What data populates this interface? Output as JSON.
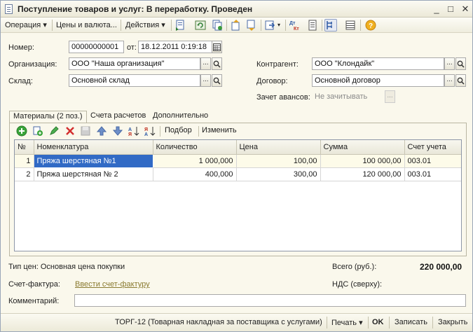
{
  "window": {
    "title": "Поступление товаров и услуг: В переработку. Проведен",
    "controls": [
      "_",
      "□",
      "✕"
    ]
  },
  "toolbar": {
    "operation": "Операция",
    "prices": "Цены и валюта...",
    "actions": "Действия",
    "icons": [
      "post-document-icon",
      "refresh-icon",
      "copy-icon",
      "move-up-icon",
      "move-down-icon",
      "go-to-icon",
      "dt-kt-icon",
      "register-icon",
      "structure-icon",
      "list-icon",
      "help-icon"
    ]
  },
  "form": {
    "number_label": "Номер:",
    "number_value": "00000000001",
    "date_label": "от:",
    "date_value": "18.12.2011  0:19:18",
    "org_label": "Организация:",
    "org_value": "ООО \"Наша организация\"",
    "warehouse_label": "Склад:",
    "warehouse_value": "Основной склад",
    "contractor_label": "Контрагент:",
    "contractor_value": "ООО \"Клондайк\"",
    "contract_label": "Договор:",
    "contract_value": "Основной договор",
    "advance_label": "Зачет авансов:",
    "advance_value": "Не зачитывать"
  },
  "tabs": [
    {
      "label": "Материалы (2 поз.)",
      "active": true
    },
    {
      "label": "Счета расчетов",
      "active": false
    },
    {
      "label": "Дополнительно",
      "active": false
    }
  ],
  "grid_toolbar": {
    "selection": "Подбор",
    "change": "Изменить"
  },
  "table": {
    "columns": [
      "№",
      "Номенклатура",
      "Количество",
      "Цена",
      "Сумма",
      "Счет учета"
    ],
    "rows": [
      [
        "1",
        "Пряжа шерстяная №1",
        "1 000,000",
        "100,00",
        "100 000,00",
        "003.01"
      ],
      [
        "2",
        "Пряжа шерстяная № 2",
        "400,000",
        "300,00",
        "120 000,00",
        "003.01"
      ]
    ]
  },
  "footer": {
    "price_type": "Тип цен: Основная цена покупки",
    "total_label": "Всего (руб.):",
    "total_value": "220 000,00",
    "invoice_label": "Счет-фактура:",
    "invoice_link": "Ввести счет-фактуру",
    "vat_label": "НДС (сверху):",
    "comment_label": "Комментарий:",
    "comment_value": ""
  },
  "bottom_bar": {
    "torg": "ТОРГ-12 (Товарная накладная за поставщика с услугами)",
    "print": "Печать",
    "ok": "OK",
    "save": "Записать",
    "close": "Закрыть"
  },
  "colors": {
    "window_bg": "#faf8ec",
    "selection": "#316ac5",
    "link": "#8a7a30"
  }
}
